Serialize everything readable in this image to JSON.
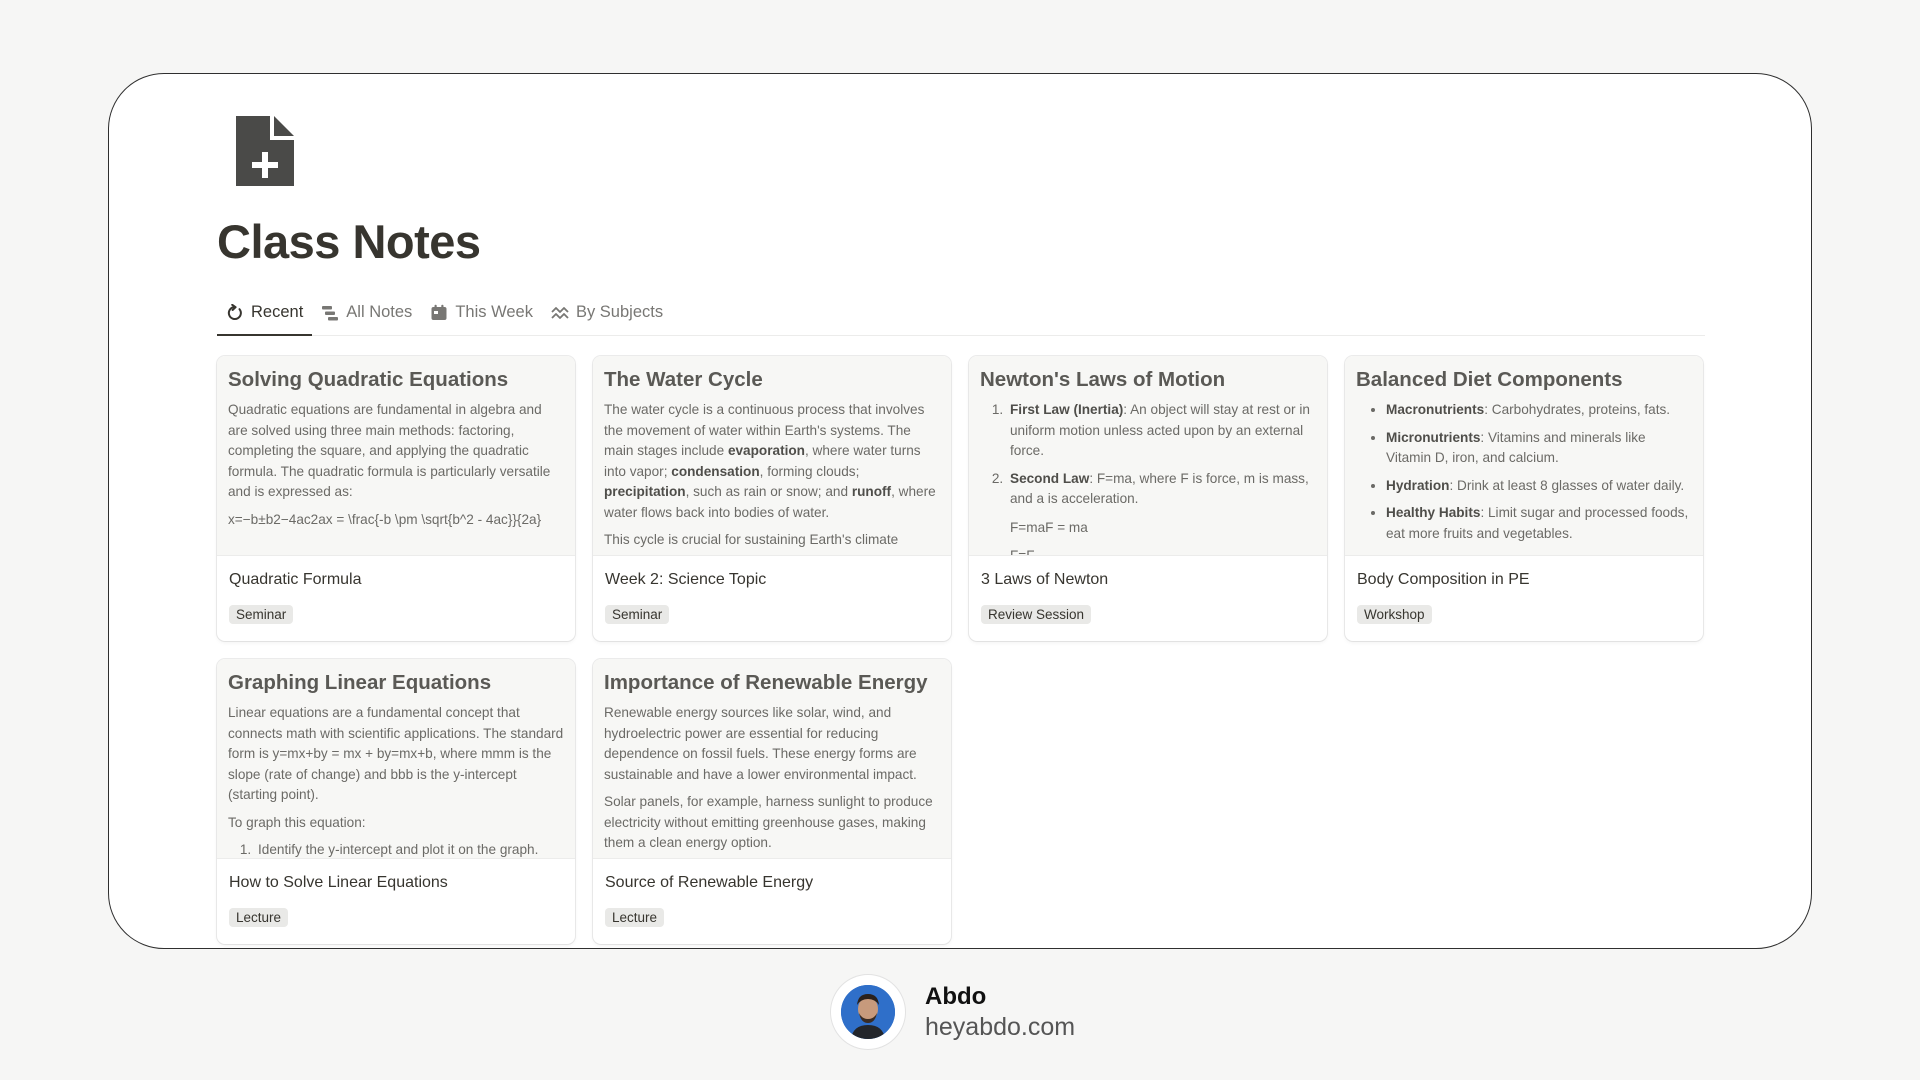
{
  "page": {
    "title": "Class Notes",
    "icon": "new-document-icon"
  },
  "tabs": [
    {
      "label": "Recent",
      "icon": "refresh-icon",
      "active": true
    },
    {
      "label": "All Notes",
      "icon": "list-icon",
      "active": false
    },
    {
      "label": "This Week",
      "icon": "calendar-icon",
      "active": false
    },
    {
      "label": "By Subjects",
      "icon": "waves-icon",
      "active": false
    }
  ],
  "cards": [
    {
      "preview_title": "Solving Quadratic Equations",
      "p1": "Quadratic equations are fundamental in algebra and are solved using three main methods: factoring, completing the square, and applying the quadratic formula. The quadratic formula is particularly versatile and is expressed as:",
      "formula": "x=−b±b2−4ac2ax = \\frac{-b \\pm \\sqrt{b^2 - 4ac}}{2a}",
      "name": "Quadratic Formula",
      "tag": "Seminar"
    },
    {
      "preview_title": "The Water Cycle",
      "p1_a": "The water cycle is a continuous process that involves the movement of water within Earth's systems. The main stages include ",
      "b1": "evaporation",
      "p1_b": ", where water turns into vapor; ",
      "b2": "condensation",
      "p1_c": ", forming clouds; ",
      "b3": "precipitation",
      "p1_d": ", such as rain or snow; and ",
      "b4": "runoff",
      "p1_e": ", where water flows back into bodies of water.",
      "p2": "This cycle is crucial for sustaining Earth's climate",
      "name": "Week 2: Science Topic",
      "tag": "Seminar"
    },
    {
      "preview_title": "Newton's Laws of Motion",
      "l1_b": "First Law (Inertia)",
      "l1_t": ": An object will stay at rest or in uniform motion unless acted upon by an external force.",
      "l2_b": "Second Law",
      "l2_t": ": F=ma, where F is force, m is mass, and a is acceleration.",
      "formula": "F=maF = ma",
      "formula2": "F=F",
      "name": "3 Laws of Newton",
      "tag": "Review Session"
    },
    {
      "preview_title": "Balanced Diet Components",
      "i1_b": "Macronutrients",
      "i1_t": ": Carbohydrates, proteins, fats.",
      "i2_b": "Micronutrients",
      "i2_t": ": Vitamins and minerals like Vitamin D, iron, and calcium.",
      "i3_b": "Hydration",
      "i3_t": ": Drink at least 8 glasses of water daily.",
      "i4_b": "Healthy Habits",
      "i4_t": ": Limit sugar and processed foods, eat more fruits and vegetables.",
      "name": "Body Composition in PE",
      "tag": "Workshop"
    },
    {
      "preview_title": "Graphing Linear Equations",
      "p1": "Linear equations are a fundamental concept that connects math with scientific applications. The standard form is y=mx+by = mx + by=mx+b, where mmm is the slope (rate of change) and bbb is the y-intercept (starting point).",
      "p2": "To graph this equation:",
      "l1": "Identify the y-intercept and plot it on the graph.",
      "name": "How to Solve Linear Equations",
      "tag": "Lecture"
    },
    {
      "preview_title": "Importance of Renewable Energy",
      "p1": "Renewable energy sources like solar, wind, and hydroelectric power are essential for reducing dependence on fossil fuels. These energy forms are sustainable and have a lower environmental impact.",
      "p2": "Solar panels, for example, harness sunlight to produce electricity without emitting greenhouse gases, making them a clean energy option.",
      "name": "Source of Renewable Energy",
      "tag": "Lecture"
    }
  ],
  "footer": {
    "name": "Abdo",
    "site": "heyabdo.com"
  }
}
